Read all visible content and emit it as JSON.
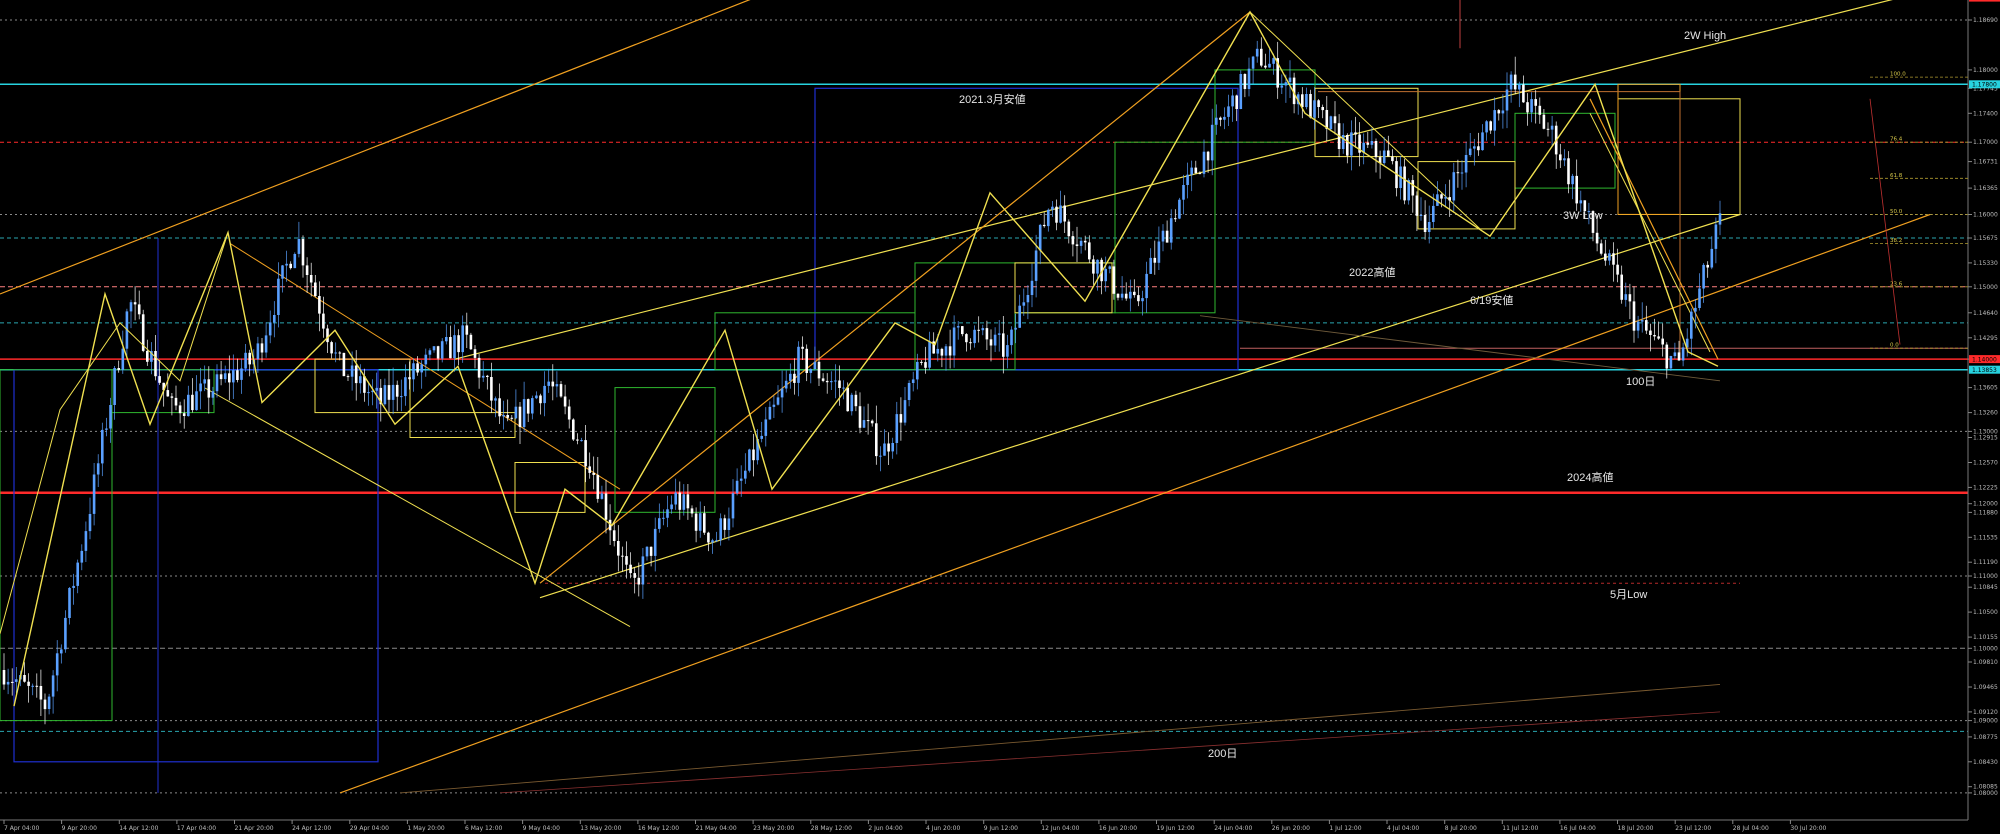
{
  "colors": {
    "background": "#000000",
    "candle_up": "#5aa0ff",
    "candle_down": "#ffffff",
    "red_level": "#ff2a2a",
    "cyan_level": "#27d3e0",
    "yellow": "#f0e050",
    "orange": "#f0a020",
    "green_box": "#2fb82f",
    "blue_box": "#1f2fd0",
    "grey_dotted": "#8a8a8a"
  },
  "chart_data": {
    "type": "candlestick",
    "symbol": "EURUSD",
    "y_axis_ticks": [
      "1.18690",
      "1.18000",
      "1.17745",
      "1.17400",
      "1.17000",
      "1.16731",
      "1.16365",
      "1.16000",
      "1.15675",
      "1.15330",
      "1.15000",
      "1.14640",
      "1.14295",
      "1.14000",
      "1.13605",
      "1.13260",
      "1.13000",
      "1.12915",
      "1.12570",
      "1.12225",
      "1.12000",
      "1.11880",
      "1.11535",
      "1.11190",
      "1.11000",
      "1.10845",
      "1.10500",
      "1.10155",
      "1.10000",
      "1.09810",
      "1.09465",
      "1.09120",
      "1.09000",
      "1.08775",
      "1.08430",
      "1.08085",
      "1.08000"
    ],
    "y_axis_tags": [
      {
        "label": "1.19000",
        "color": "#ff2a2a"
      },
      {
        "label": "1.17800",
        "color": "#27d3e0"
      },
      {
        "label": "1.14000",
        "color": "#ff2a2a"
      },
      {
        "label": "1.13853",
        "color": "#27d3e0"
      }
    ],
    "x_axis_ticks": [
      "7 Apr 04:00",
      "9 Apr 20:00",
      "14 Apr 12:00",
      "17 Apr 04:00",
      "21 Apr 20:00",
      "24 Apr 12:00",
      "29 Apr 04:00",
      "1 May 20:00",
      "6 May 12:00",
      "9 May 04:00",
      "13 May 20:00",
      "16 May 12:00",
      "21 May 04:00",
      "23 May 20:00",
      "28 May 12:00",
      "2 Jun 04:00",
      "4 Jun 20:00",
      "9 Jun 12:00",
      "12 Jun 04:00",
      "16 Jun 20:00",
      "19 Jun 12:00",
      "24 Jun 04:00",
      "26 Jun 20:00",
      "1 Jul 12:00",
      "4 Jul 04:00",
      "8 Jul 20:00",
      "11 Jul 12:00",
      "16 Jul 04:00",
      "18 Jul 20:00",
      "23 Jul 12:00",
      "28 Jul 04:00",
      "30 Jul 20:00"
    ],
    "annotations": [
      "2W High",
      "2021.3月安値",
      "3W Low",
      "2022高値",
      "6/19安値",
      "100日",
      "2024高値",
      "5月Low",
      "200日"
    ],
    "fib_levels": [
      "100.0",
      "76.4",
      "61.8",
      "50.0",
      "38.2",
      "23.6",
      "0.0"
    ],
    "price_path": [
      {
        "t": "7 Apr 04:00",
        "p": 1.097
      },
      {
        "t": "8 Apr",
        "p": 1.092
      },
      {
        "t": "9 Apr 20:00",
        "p": 1.118
      },
      {
        "t": "10 Apr",
        "p": 1.148
      },
      {
        "t": "11 Apr",
        "p": 1.133
      },
      {
        "t": "14 Apr 12:00",
        "p": 1.136
      },
      {
        "t": "17 Apr 04:00",
        "p": 1.14
      },
      {
        "t": "21 Apr 20:00",
        "p": 1.157
      },
      {
        "t": "23 Apr",
        "p": 1.139
      },
      {
        "t": "24 Apr 12:00",
        "p": 1.134
      },
      {
        "t": "25 Apr",
        "p": 1.139
      },
      {
        "t": "29 Apr 04:00",
        "p": 1.143
      },
      {
        "t": "1 May 20:00",
        "p": 1.13
      },
      {
        "t": "6 May 12:00",
        "p": 1.137
      },
      {
        "t": "9 May 04:00",
        "p": 1.126
      },
      {
        "t": "12 May",
        "p": 1.108
      },
      {
        "t": "13 May 20:00",
        "p": 1.121
      },
      {
        "t": "16 May 12:00",
        "p": 1.115
      },
      {
        "t": "21 May 04:00",
        "p": 1.128
      },
      {
        "t": "23 May 20:00",
        "p": 1.14
      },
      {
        "t": "26 May",
        "p": 1.136
      },
      {
        "t": "28 May 12:00",
        "p": 1.127
      },
      {
        "t": "2 Jun 04:00",
        "p": 1.14
      },
      {
        "t": "4 Jun 20:00",
        "p": 1.144
      },
      {
        "t": "9 Jun 12:00",
        "p": 1.141
      },
      {
        "t": "12 Jun 04:00",
        "p": 1.162
      },
      {
        "t": "16 Jun 20:00",
        "p": 1.154
      },
      {
        "t": "19 Jun 12:00",
        "p": 1.147
      },
      {
        "t": "24 Jun 04:00",
        "p": 1.161
      },
      {
        "t": "26 Jun 20:00",
        "p": 1.172
      },
      {
        "t": "1 Jul 12:00",
        "p": 1.182
      },
      {
        "t": "4 Jul 04:00",
        "p": 1.176
      },
      {
        "t": "8 Jul 20:00",
        "p": 1.17
      },
      {
        "t": "11 Jul 12:00",
        "p": 1.168
      },
      {
        "t": "16 Jul 04:00",
        "p": 1.159
      },
      {
        "t": "18 Jul 20:00",
        "p": 1.168
      },
      {
        "t": "23 Jul 12:00",
        "p": 1.178
      },
      {
        "t": "25 Jul",
        "p": 1.171
      },
      {
        "t": "28 Jul 04:00",
        "p": 1.157
      },
      {
        "t": "29 Jul",
        "p": 1.145
      },
      {
        "t": "30 Jul 20:00",
        "p": 1.139
      },
      {
        "t": "1 Aug",
        "p": 1.159
      }
    ]
  }
}
